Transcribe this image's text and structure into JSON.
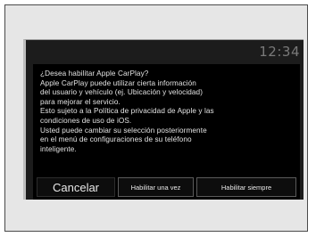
{
  "status_bar": {
    "clock": "12:34"
  },
  "dialog": {
    "message": "¿Desea habilitar Apple CarPlay?\nApple CarPlay puede utilizar cierta información\ndel usuario y vehículo (ej. Ubicación y velocidad)\npara mejorar el servicio.\nEsto sujeto a la Política de privacidad de Apple y las\ncondiciones de uso de iOS.\nUsted puede cambiar su selección posteriormente\nen el menú de configuraciones de su teléfono\ninteligente."
  },
  "buttons": {
    "cancel_label": "Cancelar",
    "enable_once_label": "Habilitar una vez",
    "enable_always_label": "Habilitar siempre"
  },
  "colors": {
    "screen_background": "#1c1c1c",
    "dialog_background": "#000000",
    "text": "#e4e4e4",
    "clock": "#7a7a7a"
  }
}
